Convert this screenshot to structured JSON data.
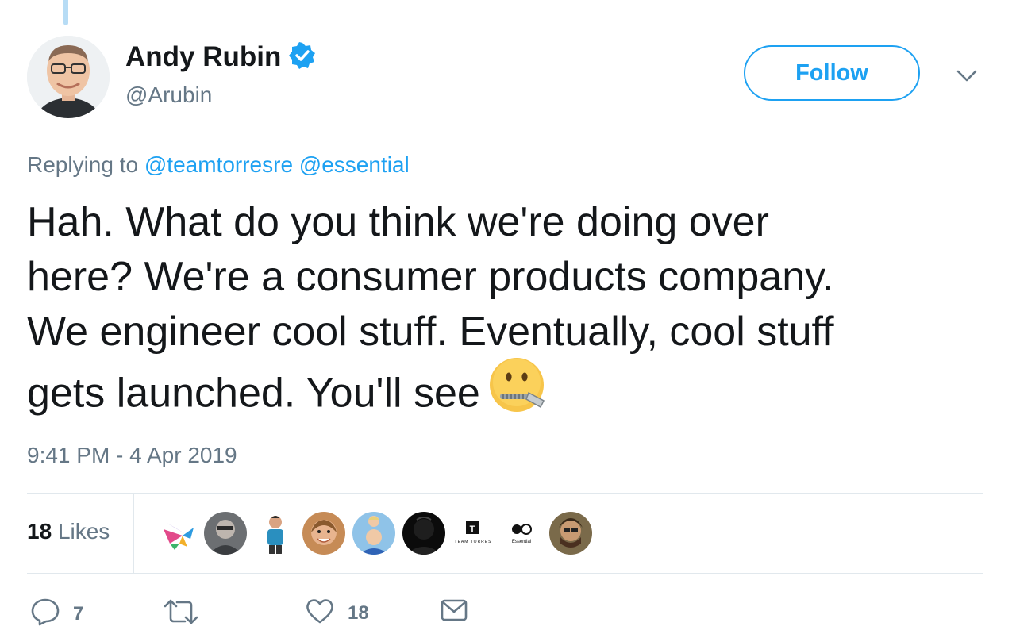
{
  "author": {
    "display_name": "Andy Rubin",
    "handle": "@Arubin",
    "verified": true,
    "avatar_icon": "profile-photo"
  },
  "follow_label": "Follow",
  "reply": {
    "prefix": "Replying to",
    "mentions": [
      "@teamtorresre",
      "@essential"
    ]
  },
  "tweet_lines": [
    "Hah.  What do you think we're doing over",
    "here?  We're a consumer products company.",
    "We engineer cool stuff.  Eventually, cool stuff",
    "gets launched.  You'll see"
  ],
  "tweet_emoji": "zipper-mouth-face",
  "timestamp": "9:41 PM - 4 Apr 2019",
  "likes": {
    "count": "18",
    "label": "Likes"
  },
  "likers": [
    {
      "icon": "bird-logo-avatar"
    },
    {
      "icon": "person-avatar"
    },
    {
      "icon": "person-avatar"
    },
    {
      "icon": "person-avatar"
    },
    {
      "icon": "person-avatar"
    },
    {
      "icon": "person-avatar"
    },
    {
      "icon": "team-torres-logo",
      "text": "TEAM TORRES",
      "letter": "T"
    },
    {
      "icon": "essential-logo",
      "text": "Essential"
    },
    {
      "icon": "person-avatar"
    }
  ],
  "actions": {
    "reply_count": "7",
    "retweet_count": "",
    "like_count": "18"
  },
  "colors": {
    "accent": "#1da1f2",
    "secondary_text": "#657786",
    "border": "#e1e8ed"
  }
}
